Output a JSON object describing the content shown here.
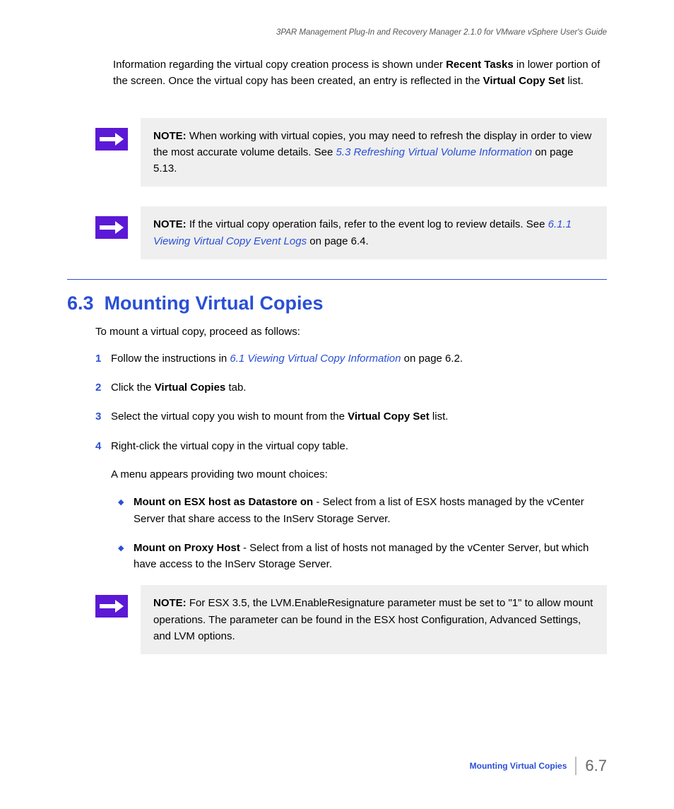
{
  "header": {
    "doc_title": "3PAR Management Plug-In and Recovery Manager 2.1.0 for VMware vSphere User's Guide"
  },
  "intro": {
    "pre1": "Information regarding the virtual copy creation process is shown under ",
    "bold1": "Recent Tasks",
    "mid1": " in lower portion of the screen. Once the virtual copy has been created, an entry is reflected in the ",
    "bold2": "Virtual Copy Set",
    "post1": " list."
  },
  "note1": {
    "label": "NOTE:",
    "p1": " When working with virtual copies, you may need to refresh the display in order to view the most accurate volume details. See ",
    "link": "5.3 Refreshing Virtual Volume Information",
    "p2": " on page 5.13."
  },
  "note2": {
    "label": "NOTE:",
    "p1": " If the virtual copy operation fails, refer to the event log to review details. See ",
    "link": "6.1.1 Viewing Virtual Copy Event Logs",
    "p2": " on page 6.4."
  },
  "section": {
    "number": "6.3",
    "title": "Mounting Virtual Copies",
    "intro": "To mount a virtual copy, proceed as follows:"
  },
  "steps": [
    {
      "num": "1",
      "pre": "Follow the instructions in ",
      "link": "6.1 Viewing Virtual Copy Information",
      "post": " on page 6.2."
    },
    {
      "num": "2",
      "pre": "Click the ",
      "bold": "Virtual Copies",
      "post": " tab."
    },
    {
      "num": "3",
      "pre": "Select the virtual copy you wish to mount from the ",
      "bold": "Virtual Copy Set",
      "post": " list."
    },
    {
      "num": "4",
      "pre": "Right-click the virtual copy in the virtual copy table."
    }
  ],
  "menu_intro": "A menu appears providing two mount choices:",
  "bullets": [
    {
      "bold": "Mount on ESX host as Datastore on",
      "rest": " - Select from a list of ESX hosts managed by the vCenter Server that share access to the InServ Storage Server."
    },
    {
      "bold": "Mount on Proxy Host",
      "rest": " - Select from a list of hosts not managed by the vCenter Server, but which have access to the InServ Storage Server."
    }
  ],
  "note3": {
    "label": "NOTE:",
    "p1": " For ESX 3.5, the LVM.EnableResignature parameter must be set to \"1\" to allow mount operations. The parameter can be found in the ESX host Configuration, Advanced Settings, and LVM options."
  },
  "footer": {
    "label": "Mounting Virtual Copies",
    "page": "6.7"
  }
}
